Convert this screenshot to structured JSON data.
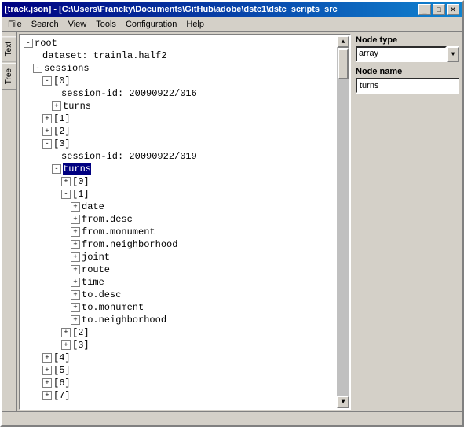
{
  "window": {
    "title": "[track.json] - [C:\\Users\\Francky\\Documents\\GitHub\\adobe\\dstc1\\dstc_scripts_src",
    "title_short": "[track.json] - [C:\\Users\\Francky\\Documents\\GitHub\\adobe\\dstc1\\dstc_scripts_src",
    "buttons": {
      "minimize": "_",
      "maximize": "□",
      "close": "✕"
    }
  },
  "menubar": {
    "items": [
      "File",
      "Search",
      "View",
      "Tools",
      "Configuration",
      "Help"
    ]
  },
  "sidebar_tabs": [
    "Text",
    "Tree"
  ],
  "right_panel": {
    "node_type_label": "Node type",
    "node_type_value": "array",
    "node_name_label": "Node name",
    "node_name_value": "turns"
  },
  "tree": {
    "nodes": [
      {
        "id": "root",
        "label": "root",
        "level": 0,
        "expanded": true,
        "icon": "-"
      },
      {
        "id": "dataset",
        "label": "dataset: trainla.half2",
        "level": 1,
        "expanded": false,
        "leaf": true
      },
      {
        "id": "sessions",
        "label": "sessions",
        "level": 1,
        "expanded": true,
        "icon": "-"
      },
      {
        "id": "s0",
        "label": "[0]",
        "level": 2,
        "expanded": true,
        "icon": "-"
      },
      {
        "id": "s0_sessionid",
        "label": "session-id: 20090922/016",
        "level": 3,
        "leaf": true
      },
      {
        "id": "s0_turns",
        "label": "turns",
        "level": 3,
        "expanded": false,
        "icon": "+"
      },
      {
        "id": "s1",
        "label": "[1]",
        "level": 2,
        "expanded": false,
        "icon": "+"
      },
      {
        "id": "s2",
        "label": "[2]",
        "level": 2,
        "expanded": false,
        "icon": "+"
      },
      {
        "id": "s3",
        "label": "[3]",
        "level": 2,
        "expanded": true,
        "icon": "-"
      },
      {
        "id": "s3_sessionid",
        "label": "session-id: 20090922/019",
        "level": 3,
        "leaf": true
      },
      {
        "id": "s3_turns",
        "label": "turns",
        "level": 3,
        "expanded": true,
        "icon": "-",
        "selected": true
      },
      {
        "id": "s3_t0",
        "label": "[0]",
        "level": 4,
        "expanded": false,
        "icon": "+"
      },
      {
        "id": "s3_t1",
        "label": "[1]",
        "level": 4,
        "expanded": true,
        "icon": "-"
      },
      {
        "id": "s3_t1_date",
        "label": "date",
        "level": 5,
        "expanded": false,
        "icon": "+"
      },
      {
        "id": "s3_t1_fromdesc",
        "label": "from.desc",
        "level": 5,
        "expanded": false,
        "icon": "+"
      },
      {
        "id": "s3_t1_frommonument",
        "label": "from.monument",
        "level": 5,
        "expanded": false,
        "icon": "+"
      },
      {
        "id": "s3_t1_fromneighborhood",
        "label": "from.neighborhood",
        "level": 5,
        "expanded": false,
        "icon": "+"
      },
      {
        "id": "s3_t1_joint",
        "label": "joint",
        "level": 5,
        "expanded": false,
        "icon": "+"
      },
      {
        "id": "s3_t1_route",
        "label": "route",
        "level": 5,
        "expanded": false,
        "icon": "+"
      },
      {
        "id": "s3_t1_time",
        "label": "time",
        "level": 5,
        "expanded": false,
        "icon": "+"
      },
      {
        "id": "s3_t1_todesc",
        "label": "to.desc",
        "level": 5,
        "expanded": false,
        "icon": "+"
      },
      {
        "id": "s3_t1_tomonument",
        "label": "to.monument",
        "level": 5,
        "expanded": false,
        "icon": "+"
      },
      {
        "id": "s3_t1_toneighborhood",
        "label": "to.neighborhood",
        "level": 5,
        "expanded": false,
        "icon": "+"
      },
      {
        "id": "s3_t2",
        "label": "[2]",
        "level": 4,
        "expanded": false,
        "icon": "+"
      },
      {
        "id": "s3_t3",
        "label": "[3]",
        "level": 4,
        "expanded": false,
        "icon": "+"
      },
      {
        "id": "s4",
        "label": "[4]",
        "level": 2,
        "expanded": false,
        "icon": "+"
      },
      {
        "id": "s5",
        "label": "[5]",
        "level": 2,
        "expanded": false,
        "icon": "+"
      },
      {
        "id": "s6",
        "label": "[6]",
        "level": 2,
        "expanded": false,
        "icon": "+"
      },
      {
        "id": "s7",
        "label": "[7]",
        "level": 2,
        "expanded": false,
        "icon": "+"
      }
    ]
  },
  "colors": {
    "selected_bg": "#000080",
    "selected_fg": "#ffffff",
    "title_bar_start": "#000080",
    "title_bar_end": "#1084d0"
  }
}
